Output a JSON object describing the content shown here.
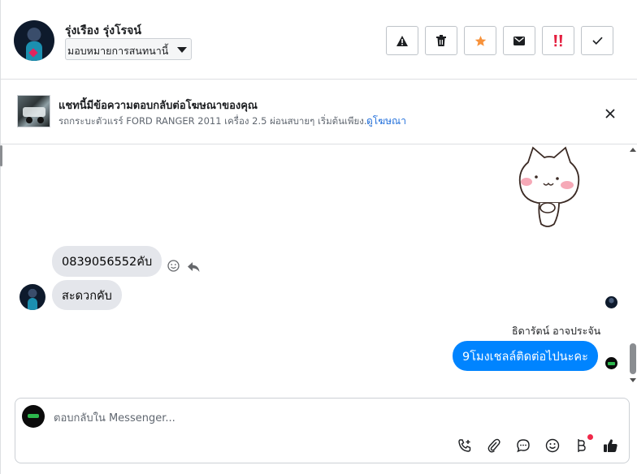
{
  "header": {
    "contact_name": "รุ่งเรือง รุ่งโรจน์",
    "assign_label": "มอบหมายการสนทนานี้",
    "actions": [
      {
        "name": "report-spam",
        "icon": "warning-icon"
      },
      {
        "name": "delete",
        "icon": "trash-icon"
      },
      {
        "name": "star",
        "icon": "star-icon",
        "color": "#f7923b"
      },
      {
        "name": "mark-unread",
        "icon": "envelope-icon"
      },
      {
        "name": "follow-up",
        "icon": "double-exclamation-icon",
        "color": "#e41e3f"
      },
      {
        "name": "mark-done",
        "icon": "check-icon"
      }
    ]
  },
  "ad_banner": {
    "title": "แชทนี้มีข้อความตอบกลับต่อโฆษณาของคุณ",
    "description": "รถกระบะตัวแรร์ FORD RANGER 2011 เครื่อง 2.5 ผ่อนสบายๆ เริ่มต้นเพียง...",
    "link": "ดูโฆษณา"
  },
  "messages": [
    {
      "direction": "in",
      "text": "0839056552คับ"
    },
    {
      "direction": "in",
      "text": "สะดวกคับ"
    },
    {
      "direction": "out",
      "sender": "ธิดารัตน์ อาจประจัน",
      "text": "9โมงเชลล์ติดต่อไปนะคะ"
    }
  ],
  "composer": {
    "placeholder": "ตอบกลับใน Messenger...",
    "value": "",
    "tools": [
      "call-plus-icon",
      "paperclip-icon",
      "chat-bubble-icon",
      "emoji-icon",
      "baht-icon",
      "thumbs-up-icon"
    ]
  },
  "colors": {
    "accent": "#0084ff",
    "incoming_bubble": "#e4e6eb",
    "star": "#f7923b",
    "alert": "#e41e3f"
  }
}
